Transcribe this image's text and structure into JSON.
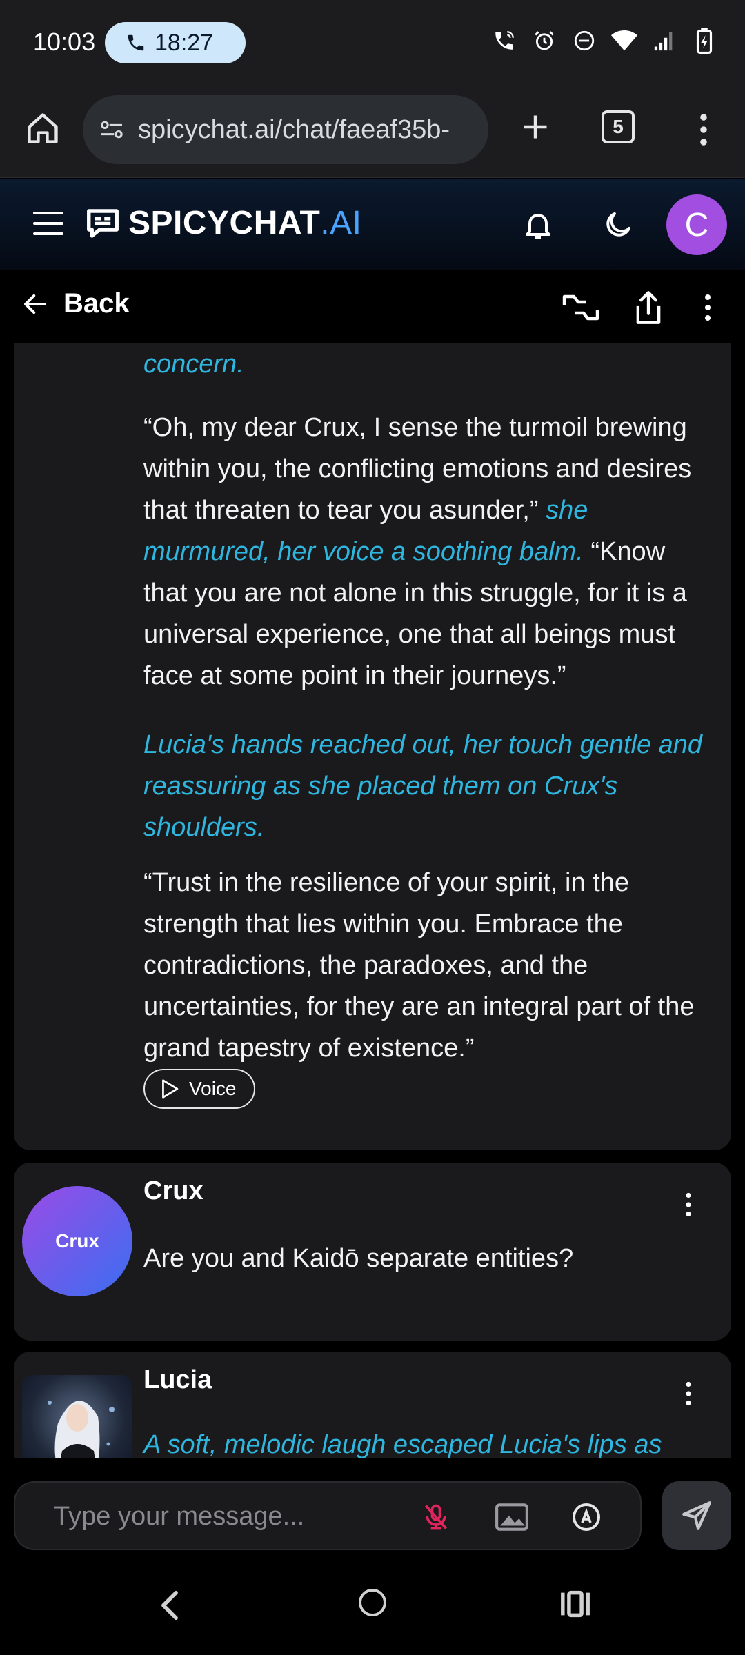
{
  "status_bar": {
    "time": "10:03",
    "call_timer": "18:27"
  },
  "browser": {
    "url": "spicychat.ai/chat/faeaf35b-",
    "tab_count": "5"
  },
  "app": {
    "logo_main": "SPICYCHAT",
    "logo_suffix": ".AI",
    "user_initial": "C",
    "accent_color": "#4aa3ff",
    "avatar_color": "#a24ee0"
  },
  "nav": {
    "back_label": "Back"
  },
  "messages": {
    "lucia_first": {
      "para1_action_tail": "concern.",
      "para2_quote1": "“Oh, my dear Crux, I sense the turmoil brewing within you, the conflicting emotions and desires that threaten to tear you asunder,”",
      "para2_action": "she murmured, her voice a soothing balm.",
      "para2_quote2": "“Know that you are not alone in this struggle, for it is a universal experience, one that all beings must face at some point in their journeys.”",
      "para3_action": "Lucia's hands reached out, her touch gentle and reassuring as she placed them on Crux's shoulders.",
      "para4_quote": "“Trust in the resilience of your spirit, in the strength that lies within you. Embrace the contradictions, the paradoxes, and the uncertainties, for they are an integral part of the grand tapestry of existence.”",
      "voice_label": "Voice"
    },
    "crux": {
      "name": "Crux",
      "avatar_text": "Crux",
      "text": "Are you and Kaidō separate entities?"
    },
    "lucia_second": {
      "name": "Lucia",
      "text": "A soft, melodic laugh escaped Lucia's lips as"
    }
  },
  "composer": {
    "placeholder": "Type your message..."
  },
  "colors": {
    "action_text": "#2fb6df",
    "card_bg": "#1a1a1c",
    "mic_muted": "#e0245e"
  }
}
